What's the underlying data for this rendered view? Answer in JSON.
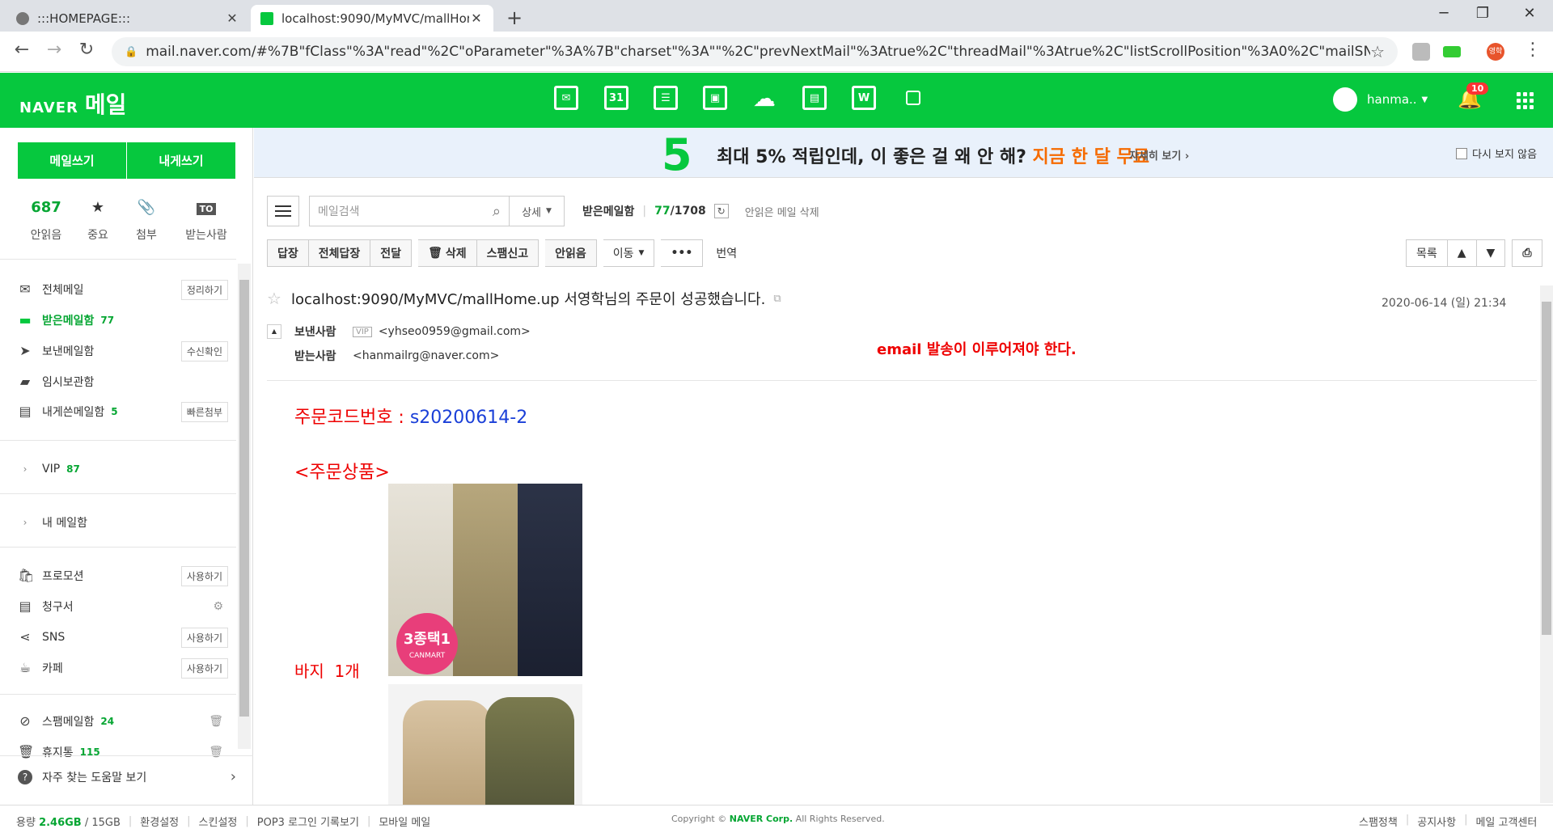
{
  "browser": {
    "tabs": [
      {
        "label": ":::HOMEPAGE:::",
        "active": false
      },
      {
        "label": "localhost:9090/MyMVC/mallHome.up",
        "active": true
      }
    ],
    "url": "mail.naver.com/#%7B\"fClass\"%3A\"read\"%2C\"oParameter\"%3A%7B\"charset\"%3A\"\"%2C\"prevNextMail\"%3Atrue%2C\"threadMail\"%3Atrue%2C\"listScrollPosition\"%3A0%2C\"mailSN\"%3A\"17367...",
    "profile_label": "영학"
  },
  "header": {
    "logo_naver": "NAVER",
    "logo_mail": "메일",
    "user_name": "hanma..",
    "notification_count": "10",
    "app_icons": [
      "mail-app-icon",
      "calendar-app-icon",
      "contacts-list-app-icon",
      "address-book-app-icon",
      "cloud-app-icon",
      "memo-app-icon",
      "office-app-icon",
      "more-app-icon"
    ],
    "calendar_day": "31"
  },
  "sidebar": {
    "write_mail": "메일쓰기",
    "write_to_me": "내게쓰기",
    "quick": [
      {
        "value": "687",
        "label": "안읽음"
      },
      {
        "value": "",
        "label": "중요"
      },
      {
        "value": "",
        "label": "첨부"
      },
      {
        "value": "TO",
        "label": "받는사람"
      }
    ],
    "mailboxes": [
      {
        "label": "전체메일",
        "count": "",
        "button": "정리하기"
      },
      {
        "label": "받은메일함",
        "count": "77",
        "button": ""
      },
      {
        "label": "보낸메일함",
        "count": "",
        "button": "수신확인"
      },
      {
        "label": "임시보관함",
        "count": "",
        "button": ""
      },
      {
        "label": "내게쓴메일함",
        "count": "5",
        "button": "빠른첨부"
      }
    ],
    "vip": {
      "label": "VIP",
      "count": "87"
    },
    "my_mailbox": "내 메일함",
    "extras": [
      {
        "label": "프로모션",
        "button": "사용하기"
      },
      {
        "label": "청구서",
        "button": ""
      },
      {
        "label": "SNS",
        "button": "사용하기"
      },
      {
        "label": "카페",
        "button": "사용하기"
      }
    ],
    "spam": {
      "label": "스팸메일함",
      "count": "24"
    },
    "trash": {
      "label": "휴지통",
      "count": "115"
    },
    "help": "자주 찾는 도움말 보기"
  },
  "promo": {
    "number": "5",
    "text_main": "최대 5% 적립인데, 이 좋은 걸 왜 안 해?",
    "text_highlight": "지금 한 달 무료",
    "more": "자세히 보기 ›",
    "dont_show": "다시 보지 않음"
  },
  "toolbar": {
    "search_placeholder": "메일검색",
    "detail": "상세",
    "inbox_label": "받은메일함",
    "unread": "77",
    "total": "/1708",
    "delete_unread": "안읽은 메일 삭제",
    "reply": "답장",
    "reply_all": "전체답장",
    "forward": "전달",
    "delete": "삭제",
    "spam": "스팸신고",
    "mark_unread": "안읽음",
    "move": "이동",
    "more": "•••",
    "translate": "번역",
    "list": "목록"
  },
  "mail": {
    "subject": "localhost:9090/MyMVC/mallHome.up 서영학님의 주문이 성공했습니다.",
    "date": "2020-06-14 (일) 21:34",
    "from_label": "보낸사람",
    "vip": "VIP",
    "from": "<yhseo0959@gmail.com>",
    "to_label": "받는사람",
    "to": "<hanmailrg@naver.com>",
    "note": "email 발송이 이루어져야 한다.",
    "order_code_label": "주문코드번호 : ",
    "order_code": "s20200614-2",
    "order_items_title": "<주문상품>",
    "item_name": "바지",
    "item_qty": "1개",
    "stamp_text": "3종택1",
    "stamp_brand": "CANMART"
  },
  "footer": {
    "usage_label": "용량",
    "usage_value": "2.46GB",
    "usage_total": "/ 15GB",
    "links_left": [
      "환경설정",
      "스킨설정",
      "POP3 로그인 기록보기",
      "모바일 메일"
    ],
    "copyright_prefix": "Copyright ©",
    "copyright_corp": "NAVER Corp.",
    "copyright_suffix": "All Rights Reserved.",
    "links_right": [
      "스팸정책",
      "공지사항",
      "메일 고객센터"
    ]
  }
}
